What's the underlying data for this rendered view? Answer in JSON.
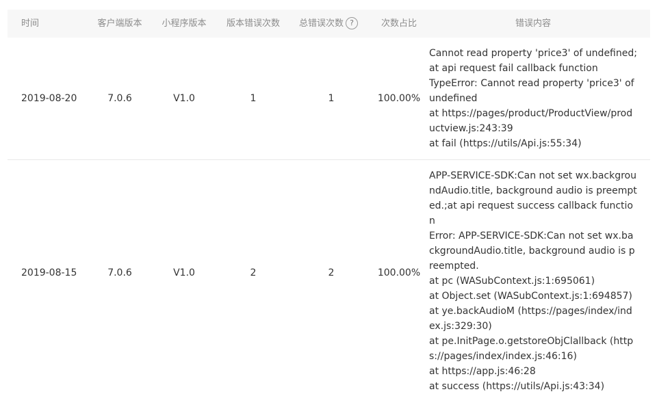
{
  "header": {
    "time": "时间",
    "client_version": "客户端版本",
    "miniprogram_version": "小程序版本",
    "version_error_count": "版本错误次数",
    "total_error_count": "总错误次数",
    "help_icon": "?",
    "ratio": "次数占比",
    "error_content": "错误内容"
  },
  "rows": [
    {
      "time": "2019-08-20",
      "client_version": "7.0.6",
      "miniprogram_version": "V1.0",
      "version_error_count": "1",
      "total_error_count": "1",
      "ratio": "100.00%",
      "error_lines": [
        "Cannot read property 'price3' of undefined;at api request fail callback function",
        "TypeError: Cannot read property 'price3' of undefined",
        "at https://pages/product/ProductView/productview.js:243:39",
        "at fail (https://utils/Api.js:55:34)"
      ]
    },
    {
      "time": "2019-08-15",
      "client_version": "7.0.6",
      "miniprogram_version": "V1.0",
      "version_error_count": "2",
      "total_error_count": "2",
      "ratio": "100.00%",
      "error_lines": [
        "APP-SERVICE-SDK:Can not set wx.backgroundAudio.title, background audio is preempted.;at api request success callback function",
        "Error: APP-SERVICE-SDK:Can not set wx.backgroundAudio.title, background audio is preempted.",
        "at pc (WASubContext.js:1:695061)",
        "at Object.set (WASubContext.js:1:694857)",
        "at ye.backAudioM (https://pages/index/index.js:329:30)",
        "at pe.InitPage.o.getstoreObjClallback (https://pages/index/index.js:46:16)",
        "at https://app.js:46:28",
        "at success (https://utils/Api.js:43:34)"
      ]
    }
  ]
}
